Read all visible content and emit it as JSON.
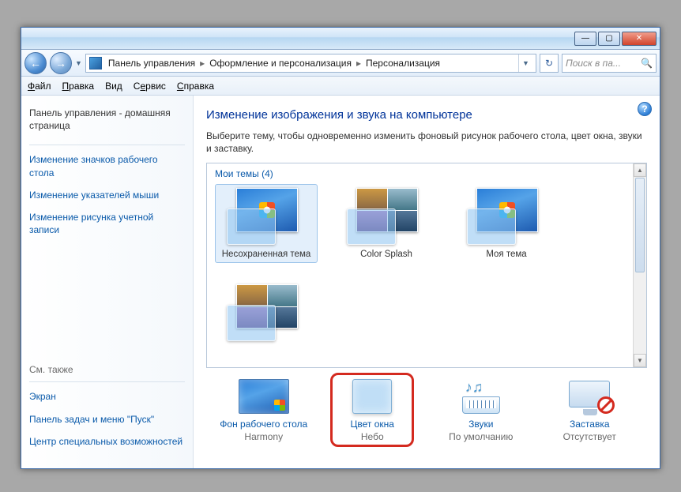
{
  "titlebar": {
    "min": "—",
    "max": "▢",
    "close": "✕"
  },
  "breadcrumb": {
    "root": "Панель управления",
    "mid": "Оформление и персонализация",
    "leaf": "Персонализация"
  },
  "search": {
    "placeholder": "Поиск в па..."
  },
  "menu": {
    "file": "Файл",
    "edit": "Правка",
    "view": "Вид",
    "tools": "Сервис",
    "help": "Справка"
  },
  "sidebar": {
    "links": [
      "Панель управления - домашняя страница",
      "Изменение значков рабочего стола",
      "Изменение указателей мыши",
      "Изменение рисунка учетной записи"
    ],
    "see_also": "См. также",
    "bottom": [
      "Экран",
      "Панель задач и меню \"Пуск\"",
      "Центр специальных возможностей"
    ]
  },
  "main": {
    "heading": "Изменение изображения и звука на компьютере",
    "sub": "Выберите тему, чтобы одновременно изменить фоновый рисунок рабочего стола, цвет окна, звуки и заставку.",
    "section": "Мои темы (4)",
    "themes": [
      {
        "label": "Несохраненная тема",
        "selected": true,
        "kind": "aero"
      },
      {
        "label": "Color Splash",
        "selected": false,
        "kind": "grid"
      },
      {
        "label": "Моя тема",
        "selected": false,
        "kind": "aero"
      },
      {
        "label": "",
        "selected": false,
        "kind": "grid"
      }
    ]
  },
  "bottom": {
    "items": [
      {
        "title": "Фон рабочего стола",
        "value": "Harmony",
        "icon": "bg",
        "hl": false
      },
      {
        "title": "Цвет окна",
        "value": "Небо",
        "icon": "color",
        "hl": true
      },
      {
        "title": "Звуки",
        "value": "По умолчанию",
        "icon": "sound",
        "hl": false
      },
      {
        "title": "Заставка",
        "value": "Отсутствует",
        "icon": "saver",
        "hl": false
      }
    ]
  }
}
